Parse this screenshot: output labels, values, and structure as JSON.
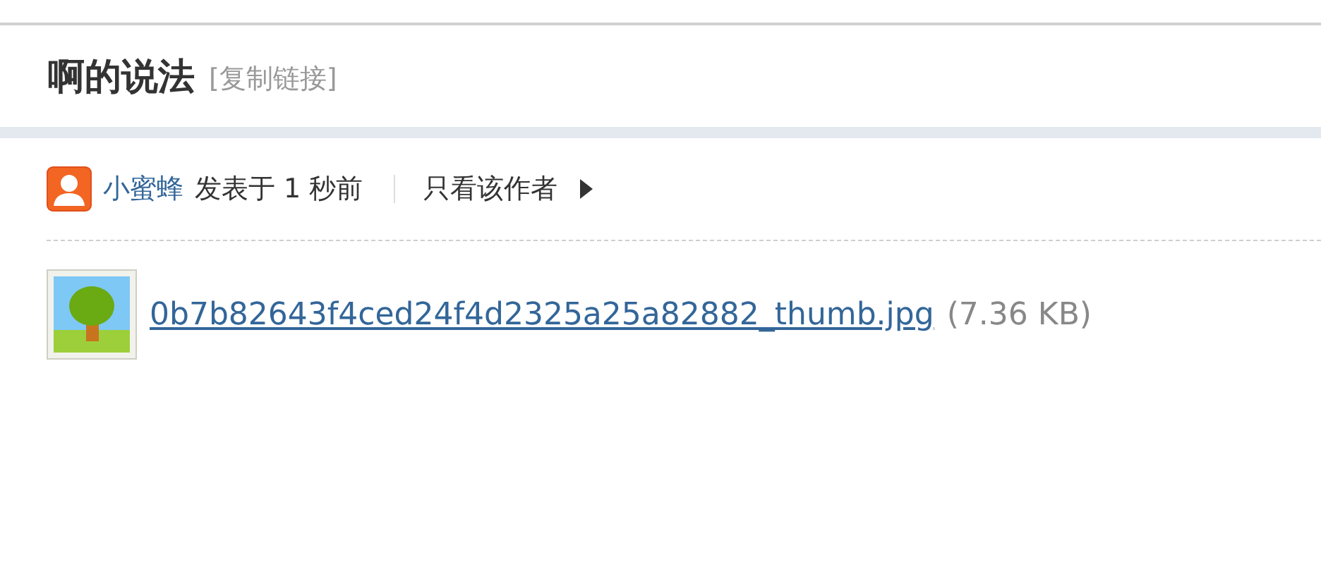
{
  "post": {
    "title": "啊的说法",
    "copy_link": "[复制链接]"
  },
  "meta": {
    "author": "小蜜蜂",
    "posted": "发表于 1 秒前",
    "only_author": "只看该作者"
  },
  "attachment": {
    "filename": "0b7b82643f4ced24f4d2325a25a82882_thumb.jpg",
    "size": "(7.36 KB)"
  }
}
